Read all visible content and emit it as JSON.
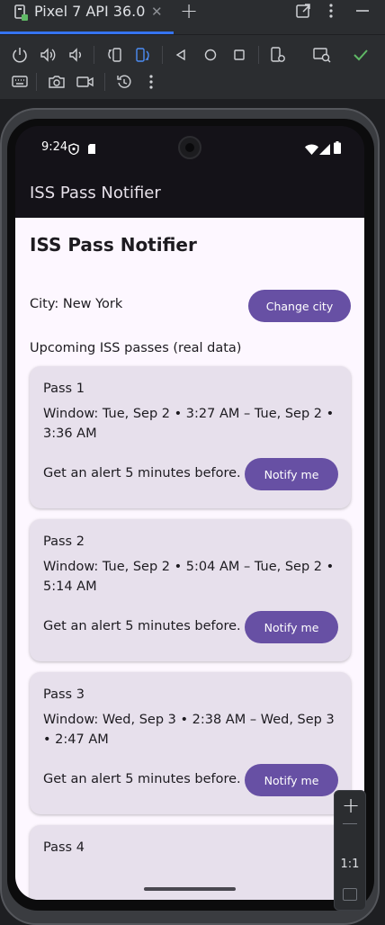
{
  "ide": {
    "tab_title": "Pixel 7 API 36.0",
    "tab_close": "✕",
    "tab_add": "+",
    "icons": [
      "device-icon",
      "external-window-icon",
      "more-vert-icon",
      "minimize-icon",
      "power-icon",
      "volume-up-icon",
      "volume-down-icon",
      "rotate-left-icon",
      "rotate-right-icon",
      "back-icon",
      "home-icon",
      "overview-icon",
      "device-settings-icon",
      "snapshot-icon",
      "checkmark-icon",
      "keyboard-icon",
      "camera-icon",
      "video-icon",
      "reset-icon",
      "more-vert-icon"
    ]
  },
  "status": {
    "time": "9:24"
  },
  "app": {
    "appbar_title": "ISS Pass Notifier",
    "page_title": "ISS Pass Notifier",
    "city_label": "City: New York",
    "change_city_label": "Change city",
    "section_label": "Upcoming ISS passes (real data)"
  },
  "passes": [
    {
      "title": "Pass 1",
      "window": "Window: Tue, Sep 2 • 3:27 AM – Tue, Sep 2 • 3:36 AM",
      "alert": "Get an alert 5 minutes before.",
      "button": "Notify me"
    },
    {
      "title": "Pass 2",
      "window": "Window: Tue, Sep 2 • 5:04 AM – Tue, Sep 2 • 5:14 AM",
      "alert": "Get an alert 5 minutes before.",
      "button": "Notify me"
    },
    {
      "title": "Pass 3",
      "window": "Window: Wed, Sep 3 • 2:38 AM – Wed, Sep 3 • 2:47 AM",
      "alert": "Get an alert 5 minutes before.",
      "button": "Notify me"
    },
    {
      "title": "Pass 4"
    }
  ],
  "zoom": {
    "plus": "+",
    "one_to_one": "1:1"
  },
  "colors": {
    "primary": "#6750a4",
    "card": "#e7e0ec",
    "surface": "#fdf7ff",
    "appbar": "#141218",
    "ide_bg": "#2b2d30",
    "tab_accent": "#3574f0",
    "confirm_green": "#5fb865"
  }
}
